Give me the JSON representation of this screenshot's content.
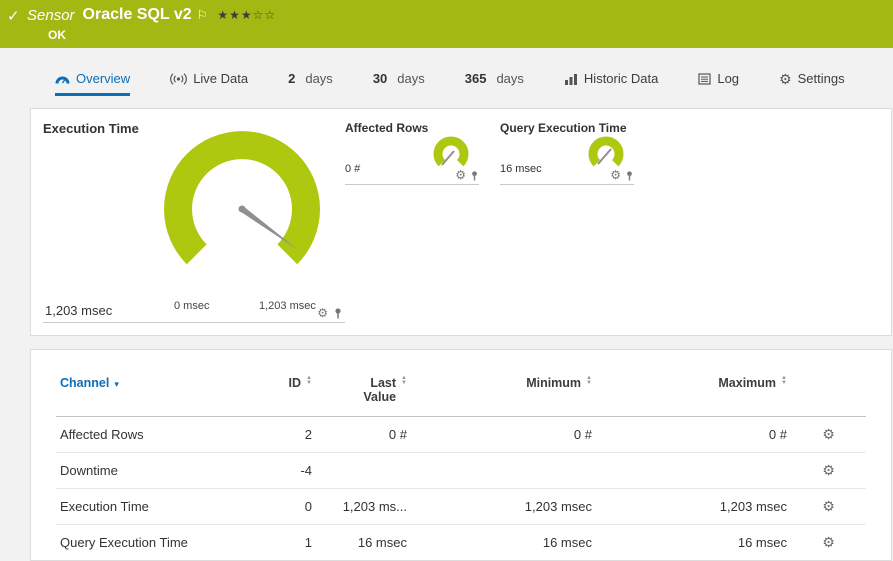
{
  "colors": {
    "header_green": "#a3b813",
    "gauge_green": "#aec70f",
    "accent_blue": "#0d6eb8"
  },
  "header": {
    "kind": "Sensor",
    "title": "Oracle SQL v2",
    "status": "OK",
    "stars": "★★★☆☆"
  },
  "tabs": {
    "overview": "Overview",
    "live_data": "Live Data",
    "d2_num": "2",
    "d2_label": "days",
    "d30_num": "30",
    "d30_label": "days",
    "d365_num": "365",
    "d365_label": "days",
    "historic": "Historic Data",
    "log": "Log",
    "settings": "Settings"
  },
  "gauge_main": {
    "title": "Execution Time",
    "value": "1,203 msec",
    "min": "0 msec",
    "max": "1,203 msec"
  },
  "gauge_small_1": {
    "title": "Affected Rows",
    "value": "0 #"
  },
  "gauge_small_2": {
    "title": "Query Execution Time",
    "value": "16 msec"
  },
  "table": {
    "col_channel": "Channel",
    "col_id": "ID",
    "col_last": "Last Value",
    "col_min": "Minimum",
    "col_max": "Maximum",
    "rows": [
      {
        "channel": "Affected Rows",
        "id": "2",
        "last": "0 #",
        "min": "0 #",
        "max": "0 #"
      },
      {
        "channel": "Downtime",
        "id": "-4",
        "last": "",
        "min": "",
        "max": ""
      },
      {
        "channel": "Execution Time",
        "id": "0",
        "last": "1,203 ms...",
        "min": "1,203 msec",
        "max": "1,203 msec"
      },
      {
        "channel": "Query Execution Time",
        "id": "1",
        "last": "16 msec",
        "min": "16 msec",
        "max": "16 msec"
      }
    ]
  }
}
